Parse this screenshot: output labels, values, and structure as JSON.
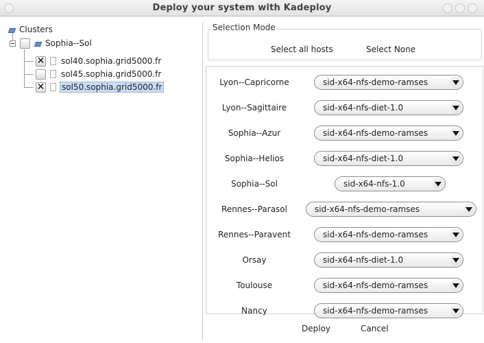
{
  "window": {
    "title": "Deploy your system with Kadeploy"
  },
  "tree": {
    "root_label": "Clusters",
    "cluster": {
      "label": "Sophia--Sol",
      "checked": false
    },
    "hosts": [
      {
        "label": "sol40.sophia.grid5000.fr",
        "checked": true,
        "check_glyph": "✕",
        "selected": false
      },
      {
        "label": "sol45.sophia.grid5000.fr",
        "checked": false,
        "check_glyph": "",
        "selected": false
      },
      {
        "label": "sol50.sophia.grid5000.fr",
        "checked": true,
        "check_glyph": "✕",
        "selected": true
      }
    ]
  },
  "selection_mode": {
    "label": "Selection Mode",
    "select_all": "Select all hosts",
    "select_none": "Select None"
  },
  "clusters": [
    {
      "name": "Lyon--Capricorne",
      "image": "sid-x64-nfs-demo-ramses"
    },
    {
      "name": "Lyon--Sagittaire",
      "image": "sid-x64-nfs-diet-1.0"
    },
    {
      "name": "Sophia--Azur",
      "image": "sid-x64-nfs-demo-ramses"
    },
    {
      "name": "Sophia--Helios",
      "image": "sid-x64-nfs-diet-1.0"
    },
    {
      "name": "Sophia--Sol",
      "image": "sid-x64-nfs-1.0"
    },
    {
      "name": "Rennes--Parasol",
      "image": "sid-x64-nfs-demo-ramses"
    },
    {
      "name": "Rennes--Paravent",
      "image": "sid-x64-nfs-demo-ramses"
    },
    {
      "name": "Orsay",
      "image": "sid-x64-nfs-diet-1.0"
    },
    {
      "name": "Toulouse",
      "image": "sid-x64-nfs-demo-ramses"
    },
    {
      "name": "Nancy",
      "image": "sid-x64-nfs-demo-ramses"
    }
  ],
  "actions": {
    "deploy": "Deploy",
    "cancel": "Cancel"
  }
}
